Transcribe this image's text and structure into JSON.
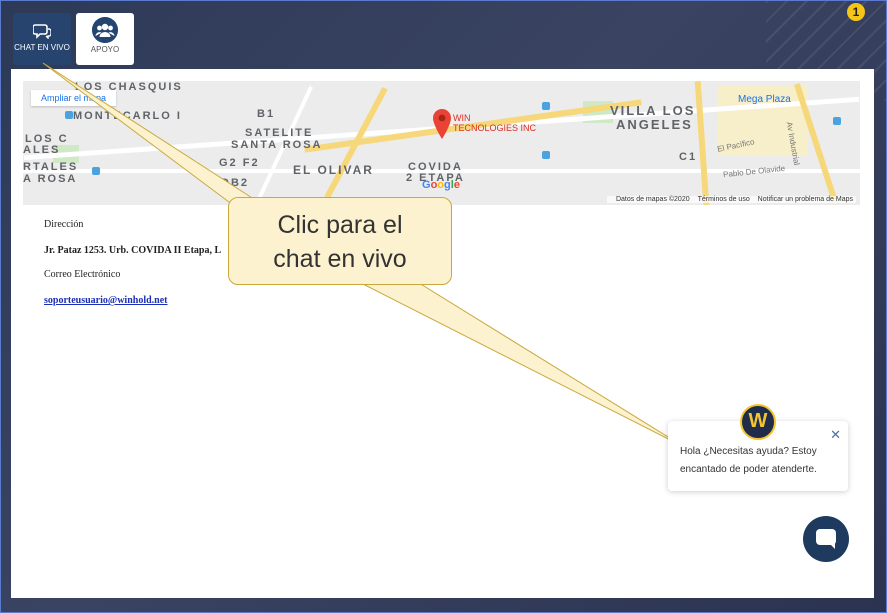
{
  "notification_count": "1",
  "tabs": [
    {
      "label": "CHAT EN VIVO",
      "icon": "chat-icon"
    },
    {
      "label": "APOYO",
      "icon": "group-icon"
    }
  ],
  "map": {
    "expand_link": "Ampliar el mapa",
    "marker_label_line1": "WIN",
    "marker_label_line2": "TECNOLOGIES INC",
    "logo": "Google",
    "footer": [
      "Datos de mapas ©2020",
      "Términos de uso",
      "Notificar un problema de Maps"
    ],
    "labels": {
      "chasquis": "LOS CHASQUIS",
      "montecarlo": "MONTECARLO I",
      "satelite": "SATELITE",
      "santa_rosa": "SANTA ROSA",
      "el_olivar": "EL OLIVAR",
      "covida": "COVIDA",
      "etapa": "2 ETAPA",
      "villa": "VILLA LOS",
      "angeles": "ANGELES",
      "mega_plaza": "Mega Plaza",
      "los_c": "LOS C",
      "ales": "ALES",
      "rtales": "RTALES",
      "arosa": "A ROSA",
      "b1": "B1",
      "g2f2": "G2 F2",
      "db2": "DB2",
      "c1": "C1",
      "av_industrial": "Av Industrial",
      "el_pacifico": "El Pacífico",
      "pablo": "Pablo De Olavide"
    }
  },
  "info": {
    "address_label": "Dirección",
    "address_value": "Jr. Pataz 1253. Urb. COVIDA II Etapa, L",
    "email_label": "Correo Electrónico",
    "email_value": "soporteusuario@winhold.net"
  },
  "callout": {
    "line1": "Clic para el",
    "line2": "chat en vivo"
  },
  "chat_bubble": {
    "line1": "Hola ¿Necesitas ayuda? Estoy",
    "line2": "encantado de poder atenderte."
  },
  "colors": {
    "accent": "#26446e",
    "callout_fill": "#fdf2cf",
    "callout_border": "#c9a93e",
    "brand_yellow": "#f4c430"
  }
}
